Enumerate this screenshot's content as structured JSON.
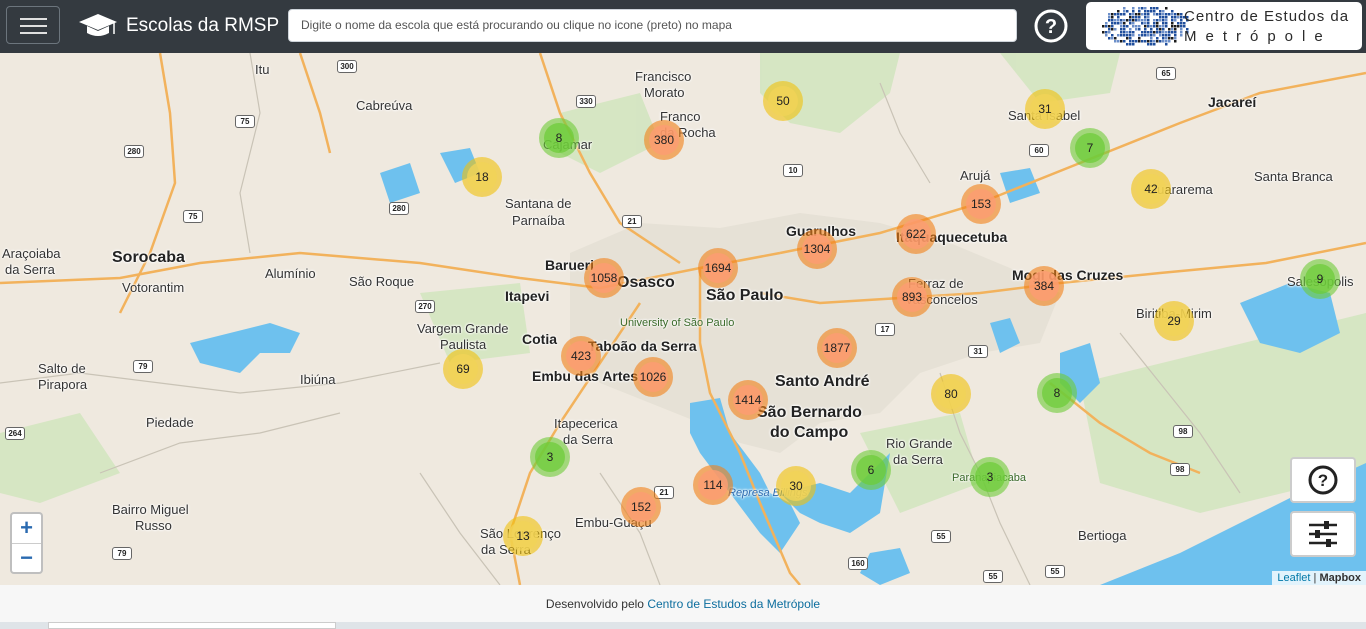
{
  "app": {
    "title": "Escolas da RMSP",
    "search_placeholder": "Digite o nome da escola que está procurando ou clique no icone (preto) no mapa",
    "logo_line1": "Centro de Estudos da",
    "logo_line2": "Metrópole",
    "menu_icon": "hamburger-icon",
    "help_icon": "question-circle-icon",
    "brand_icon": "graduation-cap-icon"
  },
  "map": {
    "zoom_in": "+",
    "zoom_out": "−",
    "attribution_leaflet": "Leaflet",
    "attribution_sep": " | ",
    "attribution_mapbox": "Mapbox",
    "places": [
      {
        "name": "Itu"
      },
      {
        "name": "Cabreúva"
      },
      {
        "name": "Francisco"
      },
      {
        "name": "Morato"
      },
      {
        "name": "Franco"
      },
      {
        "name": "da Rocha"
      },
      {
        "name": "Cajamar"
      },
      {
        "name": "Santa Isabel"
      },
      {
        "name": "Jacareí"
      },
      {
        "name": "Arujá"
      },
      {
        "name": "Santa Branca"
      },
      {
        "name": "Guararema"
      },
      {
        "name": "Santana de"
      },
      {
        "name": "Parnaíba"
      },
      {
        "name": "Guarulhos"
      },
      {
        "name": "Itaquaquecetuba"
      },
      {
        "name": "Araçoiaba"
      },
      {
        "name": "da Serra"
      },
      {
        "name": "Sorocaba"
      },
      {
        "name": "Votorantim"
      },
      {
        "name": "Alumínio"
      },
      {
        "name": "São Roque"
      },
      {
        "name": "Barueri"
      },
      {
        "name": "Osasco"
      },
      {
        "name": "São Paulo"
      },
      {
        "name": "Itapevi"
      },
      {
        "name": "University of São Paulo"
      },
      {
        "name": "Ferraz de"
      },
      {
        "name": "Vasconcelos"
      },
      {
        "name": "Mogi das Cruzes"
      },
      {
        "name": "Salesópolis"
      },
      {
        "name": "Biritiba-Mirim"
      },
      {
        "name": "Vargem Grande"
      },
      {
        "name": "Paulista"
      },
      {
        "name": "Cotia"
      },
      {
        "name": "Taboão da Serra"
      },
      {
        "name": "Embu das Artes"
      },
      {
        "name": "Santo André"
      },
      {
        "name": "São Bernardo"
      },
      {
        "name": "do Campo"
      },
      {
        "name": "Salto de"
      },
      {
        "name": "Pirapora"
      },
      {
        "name": "Ibiúna"
      },
      {
        "name": "Piedade"
      },
      {
        "name": "Itapecerica"
      },
      {
        "name": "da Serra"
      },
      {
        "name": "Rio Grande"
      },
      {
        "name": "da Serra"
      },
      {
        "name": "Paranapiacaba"
      },
      {
        "name": "Represa Billings"
      },
      {
        "name": "Bairro Miguel"
      },
      {
        "name": "Russo"
      },
      {
        "name": "Embu-Guaçu"
      },
      {
        "name": "São Lourenço"
      },
      {
        "name": "da Serra"
      },
      {
        "name": "Bertioga"
      }
    ],
    "shields": [
      "300",
      "330",
      "75",
      "280",
      "280",
      "75",
      "10",
      "21",
      "60",
      "65",
      "270",
      "79",
      "17",
      "31",
      "264",
      "21",
      "98",
      "98",
      "55",
      "79",
      "160",
      "55",
      "55"
    ],
    "clusters": [
      {
        "count": "50",
        "size": "medium"
      },
      {
        "count": "8",
        "size": "small"
      },
      {
        "count": "380",
        "size": "large"
      },
      {
        "count": "31",
        "size": "medium"
      },
      {
        "count": "7",
        "size": "small"
      },
      {
        "count": "18",
        "size": "medium"
      },
      {
        "count": "153",
        "size": "large"
      },
      {
        "count": "42",
        "size": "medium"
      },
      {
        "count": "622",
        "size": "large"
      },
      {
        "count": "1304",
        "size": "large"
      },
      {
        "count": "1694",
        "size": "large"
      },
      {
        "count": "1058",
        "size": "large"
      },
      {
        "count": "893",
        "size": "large"
      },
      {
        "count": "384",
        "size": "large"
      },
      {
        "count": "9",
        "size": "small"
      },
      {
        "count": "29",
        "size": "medium"
      },
      {
        "count": "423",
        "size": "large"
      },
      {
        "count": "1026",
        "size": "large"
      },
      {
        "count": "1877",
        "size": "large"
      },
      {
        "count": "69",
        "size": "medium"
      },
      {
        "count": "1414",
        "size": "large"
      },
      {
        "count": "80",
        "size": "medium"
      },
      {
        "count": "8",
        "size": "small"
      },
      {
        "count": "3",
        "size": "small"
      },
      {
        "count": "6",
        "size": "small"
      },
      {
        "count": "3",
        "size": "small"
      },
      {
        "count": "114",
        "size": "large"
      },
      {
        "count": "30",
        "size": "medium"
      },
      {
        "count": "152",
        "size": "large"
      },
      {
        "count": "13",
        "size": "medium"
      }
    ],
    "help_button_icon": "question-circle-icon",
    "filter_button_icon": "sliders-icon"
  },
  "footer": {
    "text": "Desenvolvido pelo ",
    "link": "Centro de Estudos da Metrópole"
  },
  "colors": {
    "navbar": "#343a40",
    "cluster_small": "#6ecc39",
    "cluster_medium": "#f0c20c",
    "cluster_large": "#f18017",
    "water": "#6ec1ee"
  }
}
